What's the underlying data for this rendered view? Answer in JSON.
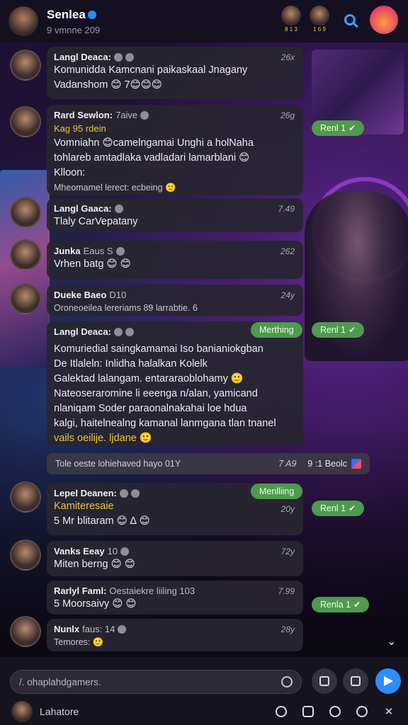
{
  "header": {
    "title": "Senlea",
    "subtitle": "9 vmnne 209",
    "mini_avatars": [
      {
        "label": "8 1 3"
      },
      {
        "label": "1 6 9"
      }
    ]
  },
  "messages": [
    {
      "name": "Langl Deaca:",
      "time": "26x",
      "lines": [
        "Komunidda Kamcnani paikaskaal Jnagany",
        "Vadanshom 😊 7😊😊😊"
      ]
    },
    {
      "name": "Rard Sewlon:",
      "tag": "7aive",
      "time": "26g",
      "lines": [
        "Kag 95 rdein",
        "Vomniahn 😊camelngamai Unghi a holNaha",
        "tohlareb amtadlaka vadladari lamarblani 😊",
        "Klloon:"
      ],
      "footer": "Mheomamel lerect: ecbeing 🙂"
    },
    {
      "name": "Langl Gaaca:",
      "time": "7.49",
      "lines": [
        "Tlaly CarVepatany"
      ]
    },
    {
      "name": "Junka",
      "tag": "Eaus S",
      "time": "262",
      "lines": [
        "Vrhen batg 😊 😊"
      ]
    },
    {
      "name": "Dueke Baeo",
      "tag": "D10",
      "time": "24y",
      "lines": [
        "Oroneoeilea  lereriams 89 larrabtie. 6"
      ]
    },
    {
      "name": "Langl Deaca:",
      "time": "",
      "lines": [
        "Komuriedial saingkamamai Iso banianiokgban",
        "De Itlaleln: Inlidha halalkan Kolelk",
        "Galektad lalangam. entararaoblohamy 🙂",
        "Nateoseraromine li eeenga n/alan, yamicand",
        "nlaniqam Soder paraonalnakahai loe hdua",
        "kalgi, haitelnealng kamanal lanmgana tlan tnanel",
        "vails oeilije. ljdane 🙂"
      ]
    },
    {
      "name": "Lepel Deanen:",
      "time": "20y",
      "lines": [
        "Kamiteresaie",
        "5 Mr blitaram 😊 ∆ 😊"
      ]
    },
    {
      "name": "Vanks Eeay",
      "tag": "10",
      "time": "72y",
      "lines": [
        "Miten berng 😊 😊"
      ]
    },
    {
      "name": "Rarlyl Faml:",
      "tag": "Oestaiekre liiling 103",
      "time": "7.99",
      "lines": [
        "5 Moorsaivy 😊 😊"
      ]
    },
    {
      "name": "Nunlx",
      "tag": "faus: 14",
      "time": "28y",
      "lines": [
        "Temores: 🙂"
      ]
    }
  ],
  "pills": [
    {
      "label": "Renl 1",
      "tick": "✔"
    },
    {
      "label": "Merthing"
    },
    {
      "label": "Renl 1",
      "tick": "✔"
    },
    {
      "label": "Menlliing"
    },
    {
      "label": "Renl 1",
      "tick": "✔"
    },
    {
      "label": "Renla 1",
      "tick": "✔"
    }
  ],
  "system_message": {
    "text": "Tole oeste lohiehaved hayo 01Y",
    "time": "7 A9",
    "right": "9 :1 Beolc"
  },
  "composer": {
    "placeholder": "/. ohaplahdgamers.",
    "user_name": "Lahatore"
  },
  "colors": {
    "accent": "#2f8cff",
    "pill": "#4f9a4e",
    "highlight": "#e9c640"
  }
}
